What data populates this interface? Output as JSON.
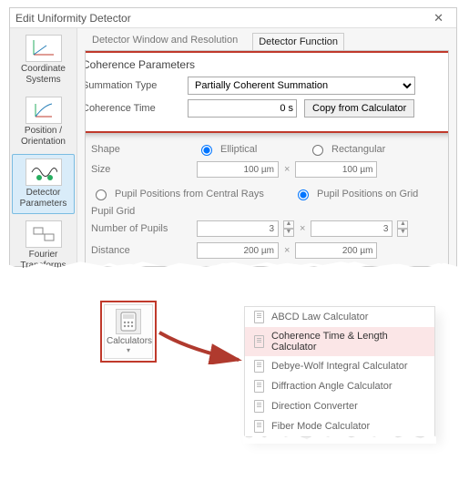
{
  "dialog": {
    "title": "Edit Uniformity Detector",
    "tabs": {
      "t1": "Detector Window and Resolution",
      "t2": "Detector Function"
    },
    "activeTab": 1
  },
  "sidebar": [
    {
      "label": "Coordinate Systems"
    },
    {
      "label": "Position / Orientation"
    },
    {
      "label": "Detector Parameters"
    },
    {
      "label": "Fourier Transforms"
    }
  ],
  "coherence": {
    "group_title": "Coherence Parameters",
    "summation_label": "Summation Type",
    "summation_value": "Partially Coherent Summation",
    "time_label": "Coherence Time",
    "time_value": "0 s",
    "copy_btn": "Copy from Calculator"
  },
  "form": {
    "shape_label": "Shape",
    "shape_opt1": "Elliptical",
    "shape_opt2": "Rectangular",
    "size_label": "Size",
    "size_val": "100 µm",
    "pos1": "Pupil Positions from Central Rays",
    "pos2": "Pupil Positions on Grid",
    "grid_label": "Pupil Grid",
    "num_label": "Number of Pupils",
    "num_val": "3",
    "dist_label": "Distance",
    "dist_val": "200 µm"
  },
  "calcbtn": {
    "label": "Calculators"
  },
  "menu": {
    "items": [
      "ABCD Law Calculator",
      "Coherence Time & Length Calculator",
      "Debye-Wolf Integral Calculator",
      "Diffraction Angle Calculator",
      "Direction Converter",
      "Fiber Mode Calculator"
    ]
  },
  "chart_data": null
}
